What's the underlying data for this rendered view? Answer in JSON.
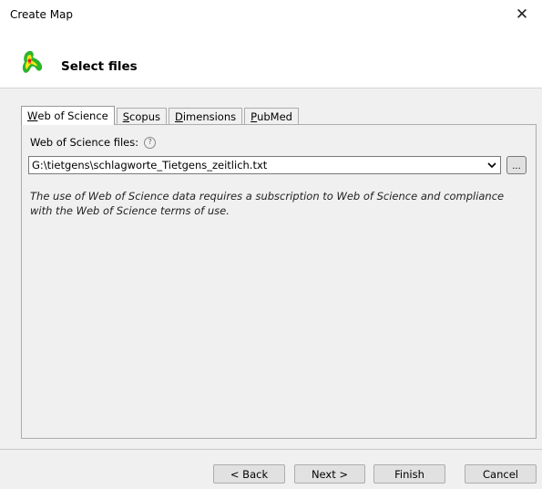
{
  "window": {
    "title": "Create Map",
    "close_glyph": "✕"
  },
  "header": {
    "title": "Select files",
    "icon": "heatmap-map-icon"
  },
  "tabs": [
    {
      "accel": "W",
      "rest": "eb of Science"
    },
    {
      "accel": "S",
      "rest": "copus"
    },
    {
      "accel": "D",
      "rest": "imensions"
    },
    {
      "accel": "P",
      "rest": "ubMed"
    }
  ],
  "panel": {
    "field_label": "Web of Science files:",
    "help_glyph": "?",
    "file_path": "G:\\tietgens\\schlagworte_Tietgens_zeitlich.txt",
    "browse_label": "...",
    "notice": "The use of Web of Science data requires a subscription to Web of Science and compliance with the Web of Science terms of use."
  },
  "buttons": {
    "back": "< Back",
    "next": "Next >",
    "finish": "Finish",
    "cancel": "Cancel"
  }
}
